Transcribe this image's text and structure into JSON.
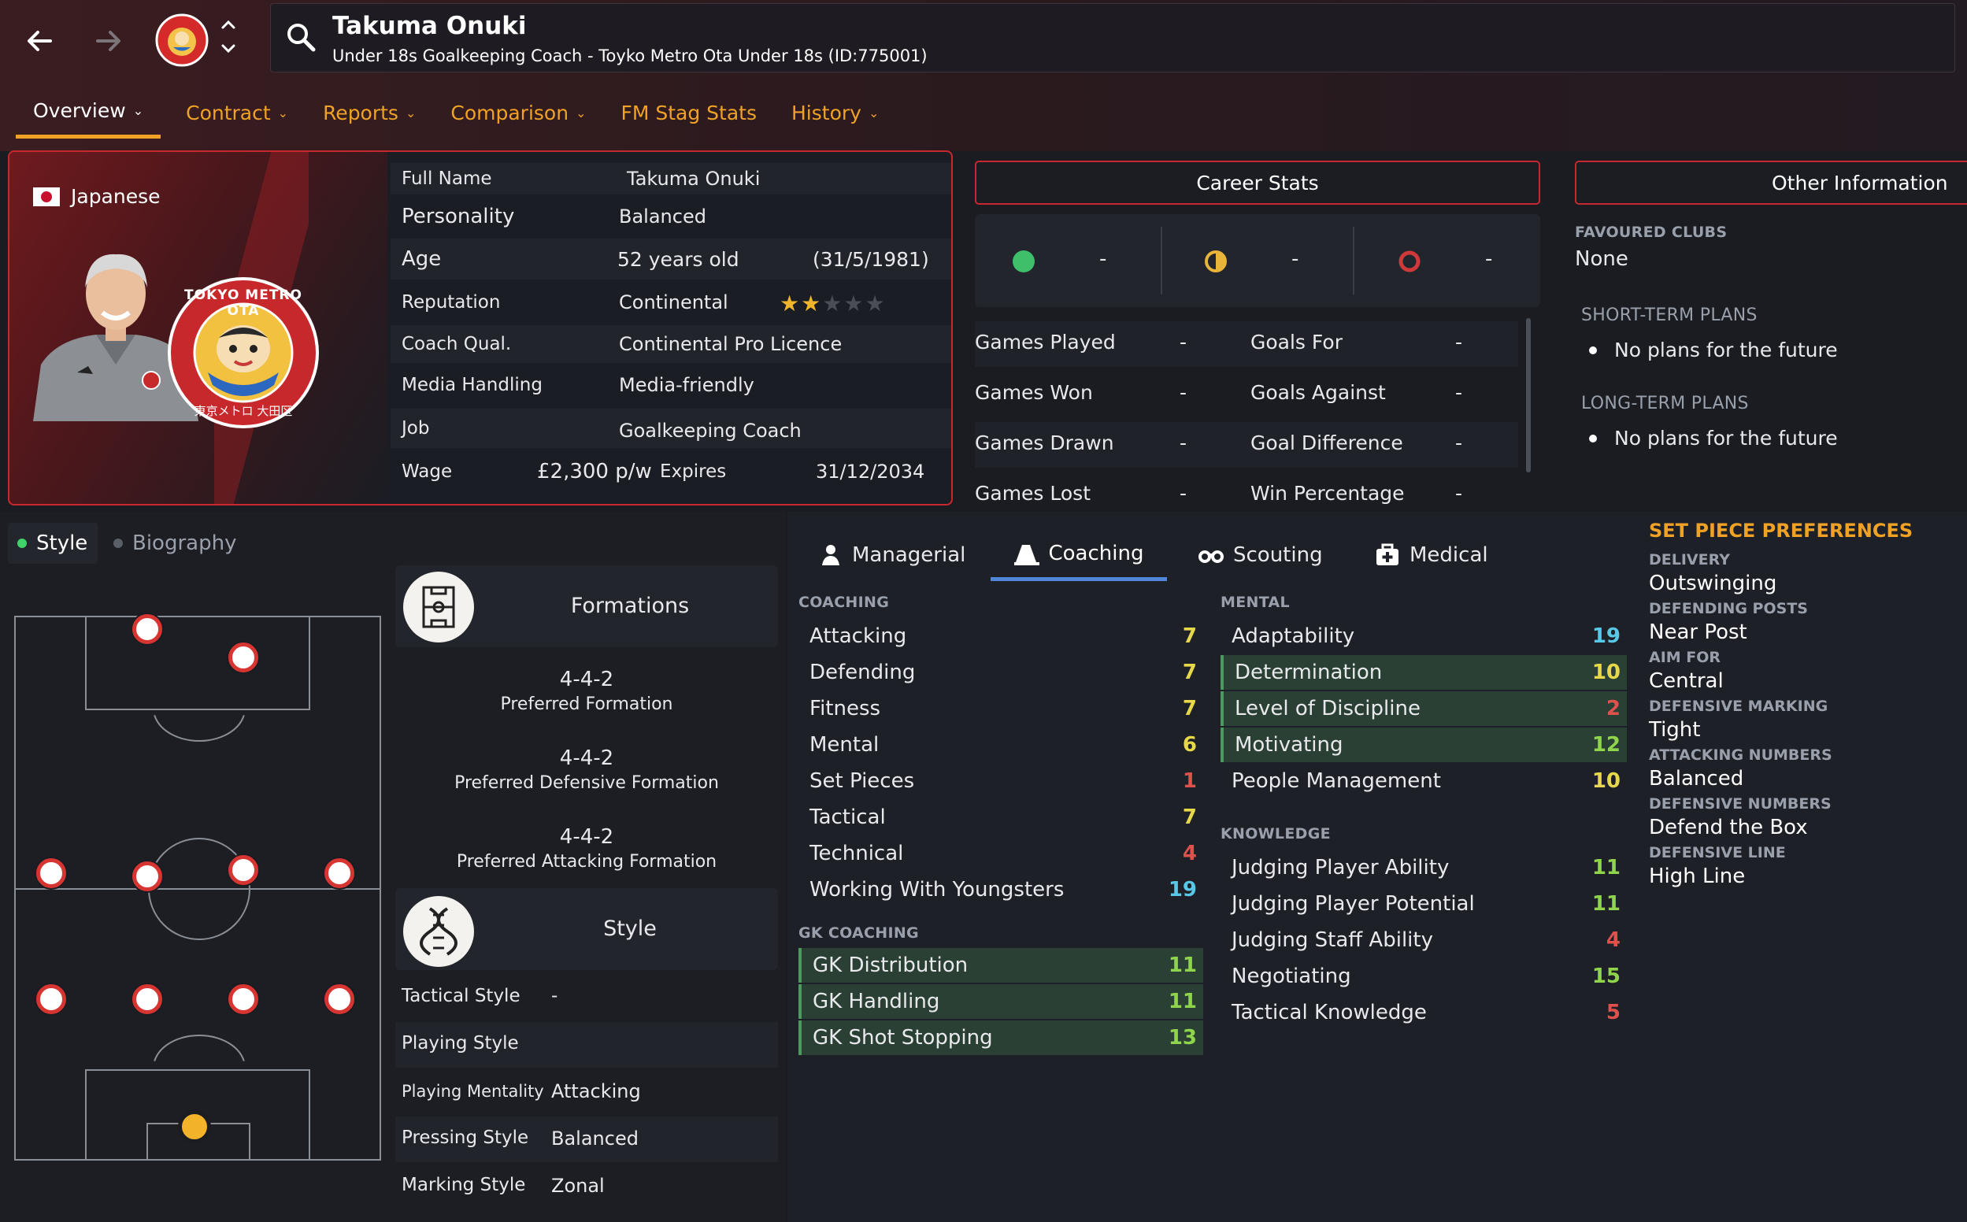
{
  "header": {
    "name": "Takuma Onuki",
    "subtitle": "Under 18s Goalkeeping Coach - Toyko Metro Ota Under 18s (ID:775001)"
  },
  "tabs": [
    {
      "label": "Overview",
      "active": true,
      "dropdown": true
    },
    {
      "label": "Contract",
      "active": false,
      "dropdown": true
    },
    {
      "label": "Reports",
      "active": false,
      "dropdown": true
    },
    {
      "label": "Comparison",
      "active": false,
      "dropdown": true
    },
    {
      "label": "FM Stag Stats",
      "active": false,
      "dropdown": false
    },
    {
      "label": "History",
      "active": false,
      "dropdown": true
    }
  ],
  "profile": {
    "nationality": "Japanese",
    "logo_top": "TOKYO METRO OTA",
    "logo_bottom": "東京メトロ 大田区",
    "rows": [
      {
        "label": "Full Name",
        "value": "Takuma Onuki"
      },
      {
        "label": "Personality",
        "value": "Balanced"
      },
      {
        "label": "Age",
        "value": "52 years old",
        "extra": "(31/5/1981)"
      },
      {
        "label": "Reputation",
        "value": "Continental"
      },
      {
        "label": "Coach Qual.",
        "value": "Continental Pro Licence"
      },
      {
        "label": "Media Handling",
        "value": "Media-friendly"
      },
      {
        "label": "Job",
        "value": "Goalkeeping Coach"
      }
    ],
    "wage_label": "Wage",
    "wage_value": "£2,300 p/w",
    "expires_label": "Expires",
    "expires_value": "31/12/2034",
    "reputation_stars": 2,
    "reputation_max": 5
  },
  "career": {
    "title": "Career Stats",
    "summary": [
      "-",
      "-",
      "-"
    ],
    "rows": [
      {
        "l1": "Games Played",
        "v1": "-",
        "l2": "Goals For",
        "v2": "-"
      },
      {
        "l1": "Games Won",
        "v1": "-",
        "l2": "Goals Against",
        "v2": "-"
      },
      {
        "l1": "Games Drawn",
        "v1": "-",
        "l2": "Goal Difference",
        "v2": "-"
      },
      {
        "l1": "Games Lost",
        "v1": "-",
        "l2": "Win Percentage",
        "v2": "-"
      }
    ]
  },
  "other": {
    "title": "Other Information",
    "favoured_label": "FAVOURED CLUBS",
    "favoured_value": "None",
    "short_label": "SHORT-TERM PLANS",
    "short_value": "No plans for the future",
    "long_label": "LONG-TERM PLANS",
    "long_value": "No plans for the future"
  },
  "subtabs": {
    "style": "Style",
    "biography": "Biography"
  },
  "formations": {
    "title": "Formations",
    "items": [
      {
        "value": "4-4-2",
        "label": "Preferred Formation"
      },
      {
        "value": "4-4-2",
        "label": "Preferred Defensive Formation"
      },
      {
        "value": "4-4-2",
        "label": "Preferred Attacking Formation"
      }
    ]
  },
  "style": {
    "title": "Style",
    "rows": [
      {
        "label": "Tactical Style",
        "value": "-"
      },
      {
        "label": "Playing Style",
        "value": ""
      },
      {
        "label": "Playing Mentality",
        "value": "Attacking"
      },
      {
        "label": "Pressing Style",
        "value": "Balanced"
      },
      {
        "label": "Marking Style",
        "value": "Zonal"
      }
    ]
  },
  "attr_tabs": [
    "Managerial",
    "Coaching",
    "Scouting",
    "Medical"
  ],
  "coaching": {
    "label": "COACHING",
    "items": [
      {
        "name": "Attacking",
        "value": "7"
      },
      {
        "name": "Defending",
        "value": "7"
      },
      {
        "name": "Fitness",
        "value": "7"
      },
      {
        "name": "Mental",
        "value": "6"
      },
      {
        "name": "Set Pieces",
        "value": "1"
      },
      {
        "name": "Tactical",
        "value": "7"
      },
      {
        "name": "Technical",
        "value": "4"
      },
      {
        "name": "Working With Youngsters",
        "value": "19"
      }
    ]
  },
  "gk": {
    "label": "GK COACHING",
    "items": [
      {
        "name": "GK Distribution",
        "value": "11"
      },
      {
        "name": "GK Handling",
        "value": "11"
      },
      {
        "name": "GK Shot Stopping",
        "value": "13"
      }
    ]
  },
  "mental": {
    "label": "MENTAL",
    "items": [
      {
        "name": "Adaptability",
        "value": "19"
      },
      {
        "name": "Determination",
        "value": "10"
      },
      {
        "name": "Level of Discipline",
        "value": "2"
      },
      {
        "name": "Motivating",
        "value": "12"
      },
      {
        "name": "People Management",
        "value": "10"
      }
    ]
  },
  "knowledge": {
    "label": "KNOWLEDGE",
    "items": [
      {
        "name": "Judging Player Ability",
        "value": "11"
      },
      {
        "name": "Judging Player Potential",
        "value": "11"
      },
      {
        "name": "Judging Staff Ability",
        "value": "4"
      },
      {
        "name": "Negotiating",
        "value": "15"
      },
      {
        "name": "Tactical Knowledge",
        "value": "5"
      }
    ]
  },
  "setpiece": {
    "title": "SET PIECE PREFERENCES",
    "items": [
      {
        "label": "DELIVERY",
        "value": "Outswinging"
      },
      {
        "label": "DEFENDING POSTS",
        "value": "Near Post"
      },
      {
        "label": "AIM FOR",
        "value": "Central"
      },
      {
        "label": "DEFENSIVE MARKING",
        "value": "Tight"
      },
      {
        "label": "ATTACKING NUMBERS",
        "value": "Balanced"
      },
      {
        "label": "DEFENSIVE NUMBERS",
        "value": "Defend the Box"
      },
      {
        "label": "DEFENSIVE LINE",
        "value": "High Line"
      }
    ]
  },
  "colors": {
    "accent": "#f0a226",
    "danger": "#c6292d",
    "win": "#3fbf6a",
    "draw": "#e8b43a",
    "loss": "#d0393a"
  }
}
